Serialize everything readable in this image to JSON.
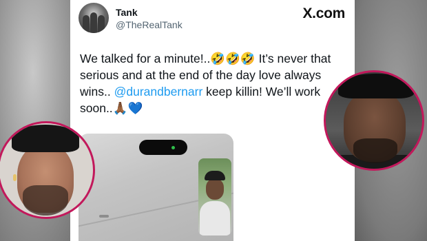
{
  "tweet": {
    "display_name": "Tank",
    "handle": "@TheRealTank",
    "brand": "X.com",
    "text_part1": "We talked for a minute!..🤣🤣🤣 It’s never that serious and at the end of the day love always wins.. ",
    "mention": "@durandbernarr",
    "text_part2": " keep killin! We’ll work soon..🙏🏾💙",
    "colors": {
      "mention": "#1d9bf0",
      "circle_border": "#c2185b"
    }
  }
}
